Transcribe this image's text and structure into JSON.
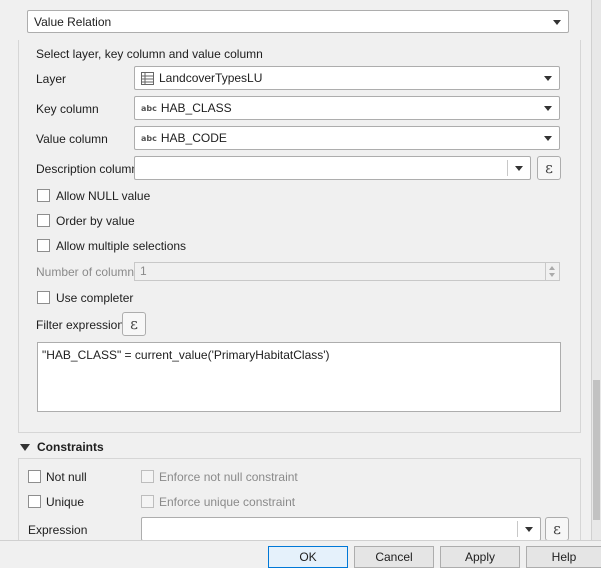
{
  "widget_type": {
    "value": "Value Relation"
  },
  "value_relation": {
    "instructions": "Select layer, key column and value column",
    "layer": {
      "label": "Layer",
      "value": "LandcoverTypesLU",
      "icon": "table-icon"
    },
    "key_column": {
      "label": "Key column",
      "value": "HAB_CLASS",
      "type_badge": "abc"
    },
    "value_column": {
      "label": "Value column",
      "value": "HAB_CODE",
      "type_badge": "abc"
    },
    "description_column": {
      "label": "Description column",
      "value": ""
    },
    "allow_null": {
      "label": "Allow NULL value",
      "checked": false
    },
    "order_by_value": {
      "label": "Order by value",
      "checked": false
    },
    "allow_multiple": {
      "label": "Allow multiple selections",
      "checked": false
    },
    "number_of_columns": {
      "label": "Number of columns",
      "value": "1"
    },
    "use_completer": {
      "label": "Use completer",
      "checked": false
    },
    "filter_expression": {
      "label": "Filter expression",
      "value": "\"HAB_CLASS\" = current_value('PrimaryHabitatClass')"
    }
  },
  "constraints": {
    "title": "Constraints",
    "not_null": {
      "label": "Not null",
      "checked": false
    },
    "enforce_not_null": {
      "label": "Enforce not null constraint",
      "checked": false
    },
    "unique": {
      "label": "Unique",
      "checked": false
    },
    "enforce_unique": {
      "label": "Enforce unique constraint",
      "checked": false
    },
    "expression": {
      "label": "Expression",
      "value": ""
    }
  },
  "buttons": {
    "ok": "OK",
    "cancel": "Cancel",
    "apply": "Apply",
    "help": "Help"
  },
  "expression_symbol": "ε"
}
